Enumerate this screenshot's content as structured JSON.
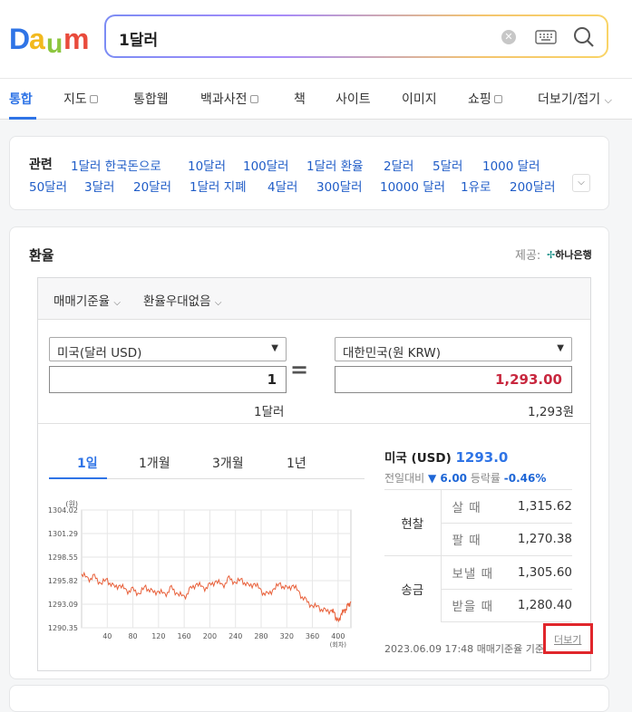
{
  "search": {
    "query": "1달러"
  },
  "tabs": [
    {
      "label": "통합",
      "active": true
    },
    {
      "label": "지도",
      "box": true
    },
    {
      "label": "통합웹"
    },
    {
      "label": "백과사전",
      "box": true
    },
    {
      "label": "책"
    },
    {
      "label": "사이트"
    },
    {
      "label": "이미지"
    },
    {
      "label": "쇼핑",
      "box": true
    },
    {
      "label": "더보기/접기"
    }
  ],
  "related": {
    "title": "관련",
    "row1": [
      "1달러 한국돈으로",
      "10달러",
      "100달러",
      "1달러 환율",
      "2달러",
      "5달러",
      "1000 달러"
    ],
    "row2": [
      "50달러",
      "3달러",
      "20달러",
      "1달러 지폐",
      "4달러",
      "300달러",
      "10000 달러",
      "1유로",
      "200달러"
    ]
  },
  "fx": {
    "title": "환율",
    "provider_label": "제공:",
    "provider_name": "하나은행",
    "rate_type": "매매기준율",
    "discount": "환율우대없음",
    "from_currency": "미국(달러 USD)",
    "to_currency": "대한민국(원 KRW)",
    "from_amount": "1",
    "to_amount": "1,293.00",
    "from_unit": "1달러",
    "to_unit": "1,293원",
    "periods": [
      "1일",
      "1개월",
      "3개월",
      "1년"
    ],
    "active_period": "1일",
    "summary_label": "미국 (USD)",
    "summary_value": "1293.0",
    "change_label": "전일대비",
    "change_value": "▼ 6.00",
    "pct_label": "등락률",
    "pct_value": "-0.46%",
    "cash_label": "현찰",
    "remit_label": "송금",
    "rows": [
      {
        "k": "살 때",
        "v": "1,315.62"
      },
      {
        "k": "팔 때",
        "v": "1,270.38"
      },
      {
        "k": "보낼 때",
        "v": "1,305.60"
      },
      {
        "k": "받을 때",
        "v": "1,280.40"
      }
    ],
    "timestamp": "2023.06.09 17:48",
    "basis": "매매기준율 기준",
    "more": "더보기"
  },
  "chart_data": {
    "type": "line",
    "ylabel": "(원)",
    "xlabel": "(회차)",
    "y_ticks": [
      "1304.02",
      "1301.29",
      "1298.55",
      "1295.82",
      "1293.09",
      "1290.35"
    ],
    "x_ticks": [
      "40",
      "80",
      "120",
      "160",
      "200",
      "240",
      "280",
      "320",
      "360",
      "400"
    ],
    "ylim": [
      1290.35,
      1304.02
    ],
    "xlim": [
      0,
      420
    ],
    "series": [
      {
        "color": "#e8603a",
        "points": [
          [
            0,
            1296.6
          ],
          [
            10,
            1296.0
          ],
          [
            20,
            1296.2
          ],
          [
            30,
            1295.5
          ],
          [
            40,
            1295.9
          ],
          [
            50,
            1295.0
          ],
          [
            60,
            1295.3
          ],
          [
            70,
            1294.6
          ],
          [
            80,
            1294.7
          ],
          [
            90,
            1294.3
          ],
          [
            100,
            1295.1
          ],
          [
            110,
            1294.4
          ],
          [
            120,
            1294.6
          ],
          [
            130,
            1294.2
          ],
          [
            140,
            1294.9
          ],
          [
            150,
            1294.3
          ],
          [
            160,
            1293.9
          ],
          [
            170,
            1294.8
          ],
          [
            180,
            1295.5
          ],
          [
            190,
            1294.9
          ],
          [
            200,
            1295.2
          ],
          [
            210,
            1295.8
          ],
          [
            220,
            1295.2
          ],
          [
            230,
            1296.0
          ],
          [
            240,
            1295.6
          ],
          [
            250,
            1295.9
          ],
          [
            260,
            1295.1
          ],
          [
            270,
            1295.5
          ],
          [
            280,
            1294.6
          ],
          [
            290,
            1294.1
          ],
          [
            300,
            1294.9
          ],
          [
            310,
            1295.4
          ],
          [
            320,
            1294.8
          ],
          [
            330,
            1295.3
          ],
          [
            340,
            1294.3
          ],
          [
            350,
            1293.4
          ],
          [
            360,
            1292.9
          ],
          [
            370,
            1292.7
          ],
          [
            380,
            1292.2
          ],
          [
            390,
            1292.4
          ],
          [
            395,
            1291.9
          ],
          [
            400,
            1290.9
          ],
          [
            405,
            1292.0
          ],
          [
            410,
            1292.3
          ],
          [
            415,
            1292.8
          ],
          [
            420,
            1293.4
          ]
        ]
      }
    ]
  }
}
